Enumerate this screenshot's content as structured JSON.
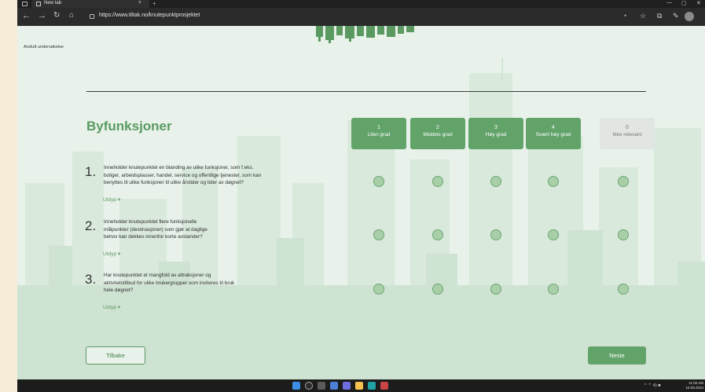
{
  "browser": {
    "tab_title": "New tab",
    "tab_close": "×",
    "new_tab": "+",
    "url": "https://www.tiltak.no/knutepunktprosjektet",
    "minimize": "—",
    "restore": "▢",
    "close": "✕"
  },
  "page": {
    "exit_link": "Avslutt undersøkelse",
    "section_title": "Byfunksjoner",
    "scale": [
      {
        "num": "1",
        "label": "Liten grad"
      },
      {
        "num": "2",
        "label": "Middels grad"
      },
      {
        "num": "3",
        "label": "Høy grad"
      },
      {
        "num": "4",
        "label": "Svært høy grad"
      },
      {
        "num": "0",
        "label": "Ikke relevant"
      }
    ],
    "questions": [
      {
        "num": "1.",
        "lines": [
          "Inneholder knutepunktet en blanding av ulike funksjoner, som f.eks.",
          "boliger, arbeidsplasser, handel, service og offentlige tjenester, som kan",
          "benyttes til ulike funksjoner til ulike årstider og tider av døgnet?"
        ],
        "expand": "Utdyp ▾"
      },
      {
        "num": "2.",
        "lines": [
          "Inneholder knutepunktet flere funksjonelle",
          "målpunkter (destinasjoner) som gjør at daglige",
          "behov kan dekkes innenfor korte avstander?"
        ],
        "expand": "Utdyp ▾"
      },
      {
        "num": "3.",
        "lines": [
          "Har knutepunktet et mangfold av attraksjoner og",
          "aktivitetstilbud for ulike brukergrupper som inviteres til bruk",
          "hele døgnet?"
        ],
        "expand": "Utdyp ▾"
      }
    ],
    "back_label": "Tilbake",
    "next_label": "Neste"
  },
  "taskbar": {
    "tray": "^ ⌔ 4) ■",
    "time": "11:00 AM",
    "date": "16.09.2024"
  },
  "colors": {
    "accent": "#62a36a",
    "title": "#5a9a61",
    "page_bg": "#e8f2ea",
    "radio_fill": "#a8cfa8"
  }
}
